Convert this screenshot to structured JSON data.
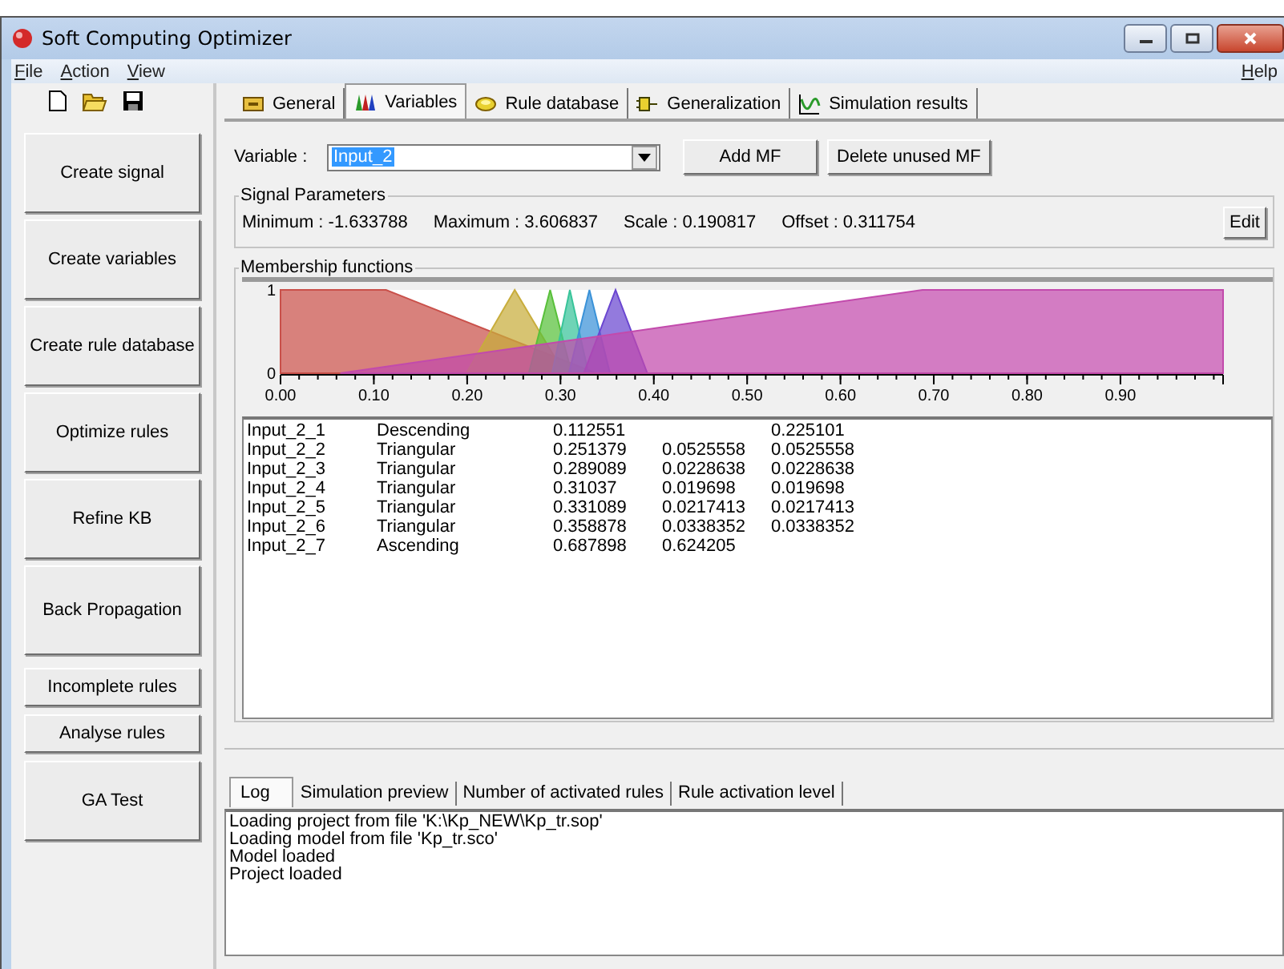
{
  "window": {
    "title": "Soft Computing Optimizer"
  },
  "menu": [
    {
      "label": "File"
    },
    {
      "label": "Action"
    },
    {
      "label": "View"
    }
  ],
  "help_menu": {
    "label": "Help"
  },
  "sidebar": {
    "buttons": [
      "Create signal",
      "Create variables",
      "Create rule database",
      "Optimize rules",
      "Refine KB",
      "Back Propagation",
      "Incomplete rules",
      "Analyse rules",
      "GA Test"
    ]
  },
  "tabs": [
    {
      "label": "General",
      "selected": false
    },
    {
      "label": "Variables",
      "selected": true
    },
    {
      "label": "Rule database",
      "selected": false
    },
    {
      "label": "Generalization",
      "selected": false
    },
    {
      "label": "Simulation results",
      "selected": false
    }
  ],
  "variable": {
    "label": "Variable :",
    "value": "Input_2",
    "buttons": [
      "Add MF",
      "Delete unused MF"
    ]
  },
  "signal_parameters": {
    "title": "Signal Parameters",
    "items": [
      "Minimum : -1.633788",
      "Maximum : 3.606837",
      "Scale : 0.190817",
      "Offset : 0.311754"
    ],
    "edit_button": "Edit"
  },
  "membership_functions": {
    "title": "Membership functions",
    "chart_data": {
      "type": "area",
      "x": [
        0,
        0.064,
        0.113,
        0.199,
        0.251,
        0.266,
        0.289,
        0.291,
        0.304,
        0.309,
        0.31,
        0.312,
        0.325,
        0.33,
        0.331,
        0.338,
        0.353,
        0.359,
        0.393,
        0.688,
        1.01
      ],
      "xlim": [
        0,
        1.01
      ],
      "ylim": [
        0,
        1
      ],
      "xticks": [
        {
          "value": 0,
          "label": "0.00"
        },
        {
          "value": 0.1,
          "label": "0.10"
        },
        {
          "value": 0.2,
          "label": "0.20"
        },
        {
          "value": 0.3,
          "label": "0.30"
        },
        {
          "value": 0.4,
          "label": "0.40"
        },
        {
          "value": 0.5,
          "label": "0.50"
        },
        {
          "value": 0.6,
          "label": "0.60"
        },
        {
          "value": 0.7,
          "label": "0.70"
        },
        {
          "value": 0.8,
          "label": "0.80"
        },
        {
          "value": 0.9,
          "label": "0.90"
        }
      ],
      "yticks": [
        0,
        1
      ],
      "series": [
        {
          "color": "#c9504a",
          "values": [
            1,
            null,
            1,
            null,
            null,
            null,
            null,
            null,
            null,
            null,
            null,
            null,
            null,
            null,
            null,
            0,
            null,
            null,
            null,
            null,
            null
          ]
        },
        {
          "color": "#c8ad3c",
          "values": [
            null,
            null,
            null,
            0,
            1,
            null,
            null,
            null,
            0,
            null,
            null,
            null,
            null,
            null,
            null,
            null,
            null,
            null,
            null,
            null,
            null
          ]
        },
        {
          "color": "#58c03a",
          "values": [
            null,
            null,
            null,
            null,
            null,
            0,
            1,
            null,
            null,
            null,
            null,
            0,
            null,
            null,
            null,
            null,
            null,
            null,
            null,
            null,
            null
          ]
        },
        {
          "color": "#38c49a",
          "values": [
            null,
            null,
            null,
            null,
            null,
            null,
            null,
            0,
            null,
            null,
            1,
            null,
            null,
            0,
            null,
            null,
            null,
            null,
            null,
            null,
            null
          ]
        },
        {
          "color": "#3a92d8",
          "values": [
            null,
            null,
            null,
            null,
            null,
            null,
            null,
            null,
            null,
            0,
            null,
            null,
            null,
            null,
            1,
            null,
            0,
            null,
            null,
            null,
            null
          ]
        },
        {
          "color": "#6a46d0",
          "values": [
            null,
            null,
            null,
            null,
            null,
            null,
            null,
            null,
            null,
            null,
            null,
            null,
            0,
            null,
            null,
            null,
            null,
            1,
            0,
            null,
            null
          ]
        },
        {
          "color": "#c24aac",
          "values": [
            null,
            0,
            null,
            null,
            null,
            null,
            null,
            null,
            null,
            null,
            null,
            null,
            null,
            null,
            null,
            null,
            null,
            null,
            null,
            1,
            1
          ]
        }
      ]
    },
    "rows": [
      {
        "column_1": "Input_2_1",
        "column_2": "Descending",
        "column_3": "0.112551",
        "column_5": "0.225101"
      },
      {
        "column_1": "Input_2_2",
        "column_2": "Triangular",
        "column_3": "0.251379",
        "column_4": "0.0525558",
        "column_5": "0.0525558"
      },
      {
        "column_1": "Input_2_3",
        "column_2": "Triangular",
        "column_3": "0.289089",
        "column_4": "0.0228638",
        "column_5": "0.0228638"
      },
      {
        "column_1": "Input_2_4",
        "column_2": "Triangular",
        "column_3": "0.31037",
        "column_4": "0.019698",
        "column_5": "0.019698"
      },
      {
        "column_1": "Input_2_5",
        "column_2": "Triangular",
        "column_3": "0.331089",
        "column_4": "0.0217413",
        "column_5": "0.0217413"
      },
      {
        "column_1": "Input_2_6",
        "column_2": "Triangular",
        "column_3": "0.358878",
        "column_4": "0.0338352",
        "column_5": "0.0338352"
      },
      {
        "column_1": "Input_2_7",
        "column_2": "Ascending",
        "column_3": "0.687898",
        "column_4": "0.624205"
      }
    ]
  },
  "bottom_tabs": [
    {
      "label": "Log",
      "selected": true
    },
    {
      "label": "Simulation preview",
      "selected": false
    },
    {
      "label": "Number of activated rules",
      "selected": false
    },
    {
      "label": "Rule activation level",
      "selected": false
    }
  ],
  "log": [
    "Loading project from file 'K:\\Kp_NEW\\Kp_tr.sop'",
    "Loading model from file 'Kp_tr.sco'",
    "Model loaded",
    "Project loaded"
  ]
}
